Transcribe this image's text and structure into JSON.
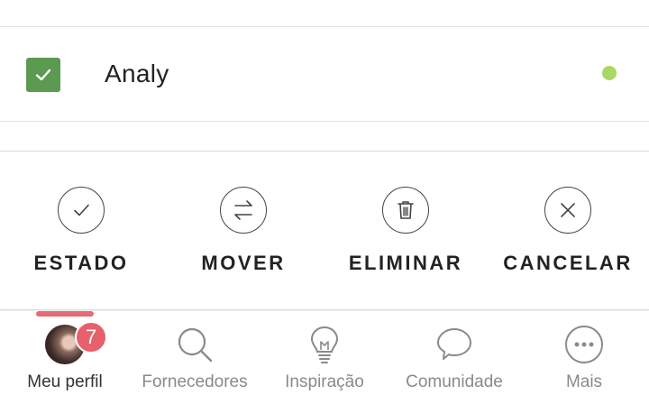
{
  "list": {
    "row": {
      "name": "Analy",
      "checked": true,
      "status_color": "#a7d964"
    }
  },
  "actions": [
    {
      "label": "ESTADO",
      "icon": "check-circle-icon"
    },
    {
      "label": "MOVER",
      "icon": "swap-arrows-icon"
    },
    {
      "label": "ELIMINAR",
      "icon": "trash-icon"
    },
    {
      "label": "CANCELAR",
      "icon": "close-circle-icon"
    }
  ],
  "tabs": [
    {
      "label": "Meu perfil",
      "icon": "avatar",
      "badge": "7",
      "active": true
    },
    {
      "label": "Fornecedores",
      "icon": "search-icon"
    },
    {
      "label": "Inspiração",
      "icon": "lightbulb-icon"
    },
    {
      "label": "Comunidade",
      "icon": "speech-bubble-icon"
    },
    {
      "label": "Mais",
      "icon": "more-dots-icon"
    }
  ],
  "colors": {
    "accent": "#e66b73",
    "checkbox": "#5c9a52",
    "badge": "#e6616c"
  }
}
